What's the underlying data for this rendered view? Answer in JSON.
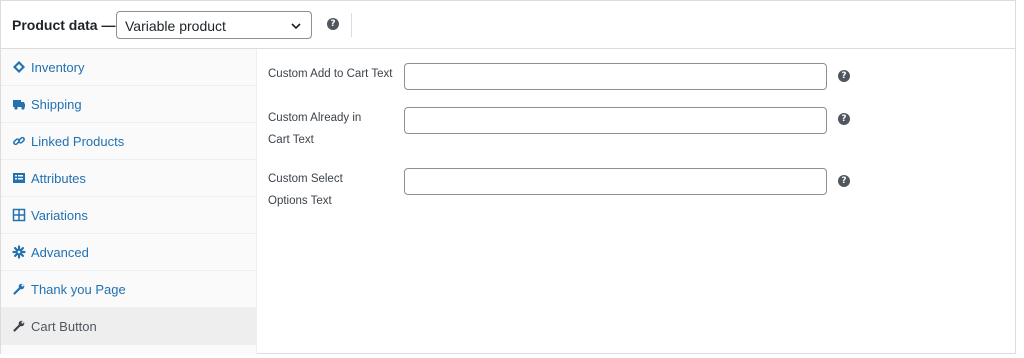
{
  "header": {
    "title": "Product data —",
    "product_type": "Variable product",
    "help_glyph": "?"
  },
  "tabs": [
    {
      "label": "Inventory",
      "icon": "tag-icon",
      "active": false
    },
    {
      "label": "Shipping",
      "icon": "truck-icon",
      "active": false
    },
    {
      "label": "Linked Products",
      "icon": "link-icon",
      "active": false
    },
    {
      "label": "Attributes",
      "icon": "list-icon",
      "active": false
    },
    {
      "label": "Variations",
      "icon": "grid-icon",
      "active": false
    },
    {
      "label": "Advanced",
      "icon": "gear-icon",
      "active": false
    },
    {
      "label": "Thank you Page",
      "icon": "wrench-icon",
      "active": false
    },
    {
      "label": "Cart Button",
      "icon": "wrench-icon",
      "active": true
    }
  ],
  "fields": [
    {
      "label_lines": [
        "Custom Add to Cart Text"
      ],
      "value": "",
      "help": "?"
    },
    {
      "label_lines": [
        "Custom Already in",
        "Cart Text"
      ],
      "value": "",
      "help": "?"
    },
    {
      "label_lines": [
        "Custom Select",
        "Options Text"
      ],
      "value": "",
      "help": "?"
    }
  ],
  "colors": {
    "link": "#2271b1",
    "active_tab_bg": "#eeeeee",
    "border": "#dcdcde"
  }
}
